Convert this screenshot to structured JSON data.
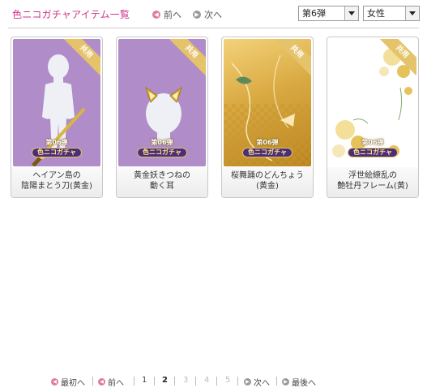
{
  "header": {
    "title": "色ニコガチャアイテム一覧",
    "prev_label": "前へ",
    "next_label": "次へ",
    "series_select": "第6弾",
    "gender_select": "女性"
  },
  "cards": [
    {
      "ribbon": "共用",
      "badge_top": "第06弾",
      "badge_bottom": "色ニコガチャ",
      "line1": "ヘイアン島の",
      "line2": "陰陽まとう刀(黄金)"
    },
    {
      "ribbon": "共用",
      "badge_top": "第06弾",
      "badge_bottom": "色ニコガチャ",
      "line1": "黄金妖きつねの",
      "line2": "動く耳"
    },
    {
      "ribbon": "共用",
      "badge_top": "第06弾",
      "badge_bottom": "色ニコガチャ",
      "line1": "桜舞踊のどんちょう",
      "line2": "(黄金)"
    },
    {
      "ribbon": "共用",
      "badge_top": "第06弾",
      "badge_bottom": "色ニコガチャ",
      "line1": "浮世絵繚乱の",
      "line2": "艶牡丹フレーム(黄)"
    }
  ],
  "pager": {
    "first_label": "最初へ",
    "prev_label": "前へ",
    "pages": [
      "1",
      "2",
      "3",
      "4",
      "5"
    ],
    "current_page": "2",
    "next_label": "次へ",
    "last_label": "最後へ"
  },
  "colors": {
    "title": "#d0338a",
    "card1_bg": "#b08cc8",
    "card2_bg": "#b08cc8",
    "card3_bg": "#d9a941",
    "ribbon": "#e4c36a"
  }
}
